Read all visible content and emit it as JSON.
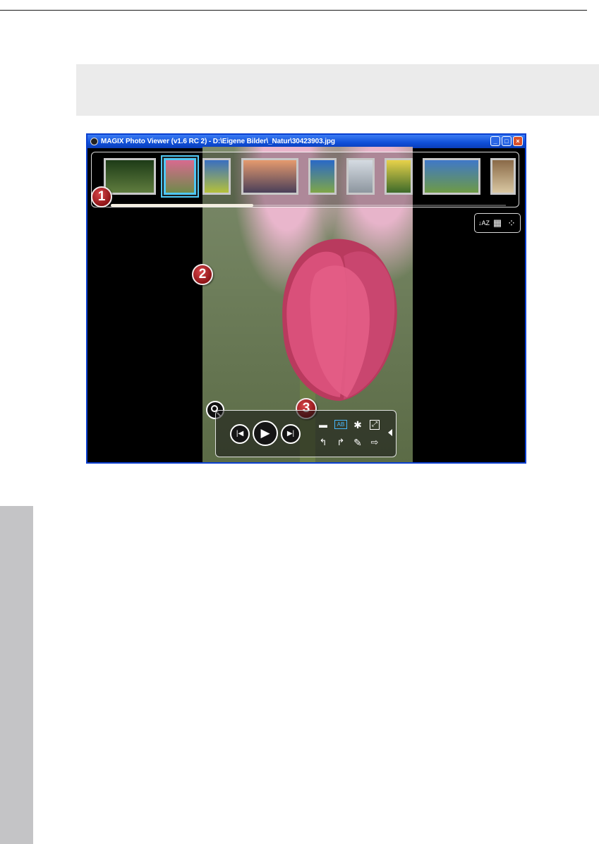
{
  "window": {
    "title": "MAGIX Photo Viewer (v1.6 RC 2) - D:\\Eigene Bilder\\_Natur\\30423903.jpg",
    "controls": {
      "minimize": "_",
      "maximize": "□",
      "close": "×"
    }
  },
  "thumbnails": [
    {
      "name": "leaves",
      "colors": [
        "#1d3b17",
        "#5f7c3e"
      ]
    },
    {
      "name": "tulip",
      "colors": [
        "#d86a8f",
        "#6f8a4b"
      ],
      "active": true
    },
    {
      "name": "tree-field",
      "colors": [
        "#3a6fc0",
        "#b5c13a"
      ]
    },
    {
      "name": "bare-tree",
      "colors": [
        "#e59a6e",
        "#4a3f59"
      ]
    },
    {
      "name": "sky-field",
      "colors": [
        "#2a69c7",
        "#7fa648"
      ]
    },
    {
      "name": "birds",
      "colors": [
        "#d5dbe2",
        "#8d969f"
      ]
    },
    {
      "name": "yellow-tulips",
      "colors": [
        "#e8d24a",
        "#3d6a2a"
      ]
    },
    {
      "name": "landscape",
      "colors": [
        "#3f78c8",
        "#6e9a45"
      ]
    },
    {
      "name": "sepia",
      "colors": [
        "#8a6a48",
        "#d9c7a2"
      ]
    }
  ],
  "scroll_position": 0.36,
  "sort_tools": [
    {
      "icon": "sort-az-icon",
      "glyph": "↓AZ"
    },
    {
      "icon": "calendar-icon",
      "glyph": "▦"
    },
    {
      "icon": "view-options-icon",
      "glyph": "⁘"
    }
  ],
  "callouts": [
    "1",
    "2",
    "3"
  ],
  "playback": {
    "prev_glyph": "|◀",
    "play_glyph": "▶",
    "next_glyph": "▶|"
  },
  "tools": [
    {
      "icon": "open-folder-icon",
      "glyph": "▬"
    },
    {
      "icon": "text-overlay-icon",
      "glyph": "AB"
    },
    {
      "icon": "settings-gear-icon",
      "glyph": "✱"
    },
    {
      "icon": "fullscreen-icon",
      "glyph": "⤢"
    },
    {
      "icon": "rotate-left-icon",
      "glyph": "↰"
    },
    {
      "icon": "rotate-right-icon",
      "glyph": "↱"
    },
    {
      "icon": "edit-pencil-icon",
      "glyph": "✎"
    },
    {
      "icon": "export-icon",
      "glyph": "⇨"
    }
  ]
}
